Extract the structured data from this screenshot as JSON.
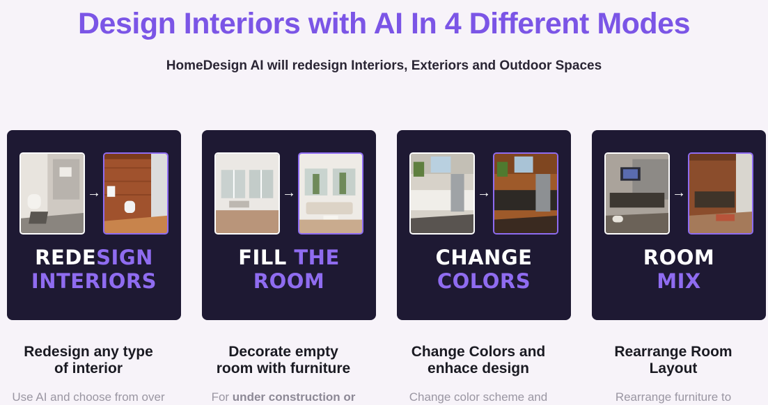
{
  "header": {
    "title": "Design Interiors with AI In 4 Different Modes",
    "subtitle": "HomeDesign AI will redesign Interiors, Exteriors and Outdoor Spaces"
  },
  "colors": {
    "accent": "#7b55e6",
    "card_bg": "#1e1933",
    "card_title_purple": "#8f6cf0",
    "page_bg": "#f7f3f9"
  },
  "modes": [
    {
      "card_line1_white": "REDE",
      "card_line1_purple": "SIGN",
      "card_line2": "INTERIORS",
      "arrow": "→",
      "title_line1": "Redesign any type",
      "title_line2": "of interior",
      "desc_plain": "Use AI and choose from over",
      "desc_bold": ""
    },
    {
      "card_line1_white": "FILL ",
      "card_line1_purple": "THE",
      "card_line2": "ROOM",
      "arrow": "→",
      "title_line1": "Decorate empty",
      "title_line2": "room with furniture",
      "desc_plain": "For ",
      "desc_bold": "under construction or"
    },
    {
      "card_line1_white": "CHANGE",
      "card_line1_purple": "",
      "card_line2": "COLORS",
      "arrow": "→",
      "title_line1": "Change Colors and",
      "title_line2": "enhace design",
      "desc_plain": "Change color scheme and",
      "desc_bold": ""
    },
    {
      "card_line1_white": "ROOM",
      "card_line1_purple": "",
      "card_line2": "MIX",
      "arrow": "→",
      "title_line1": "Rearrange Room",
      "title_line2": "Layout",
      "desc_plain": "Rearrange furniture to",
      "desc_bold": ""
    }
  ]
}
